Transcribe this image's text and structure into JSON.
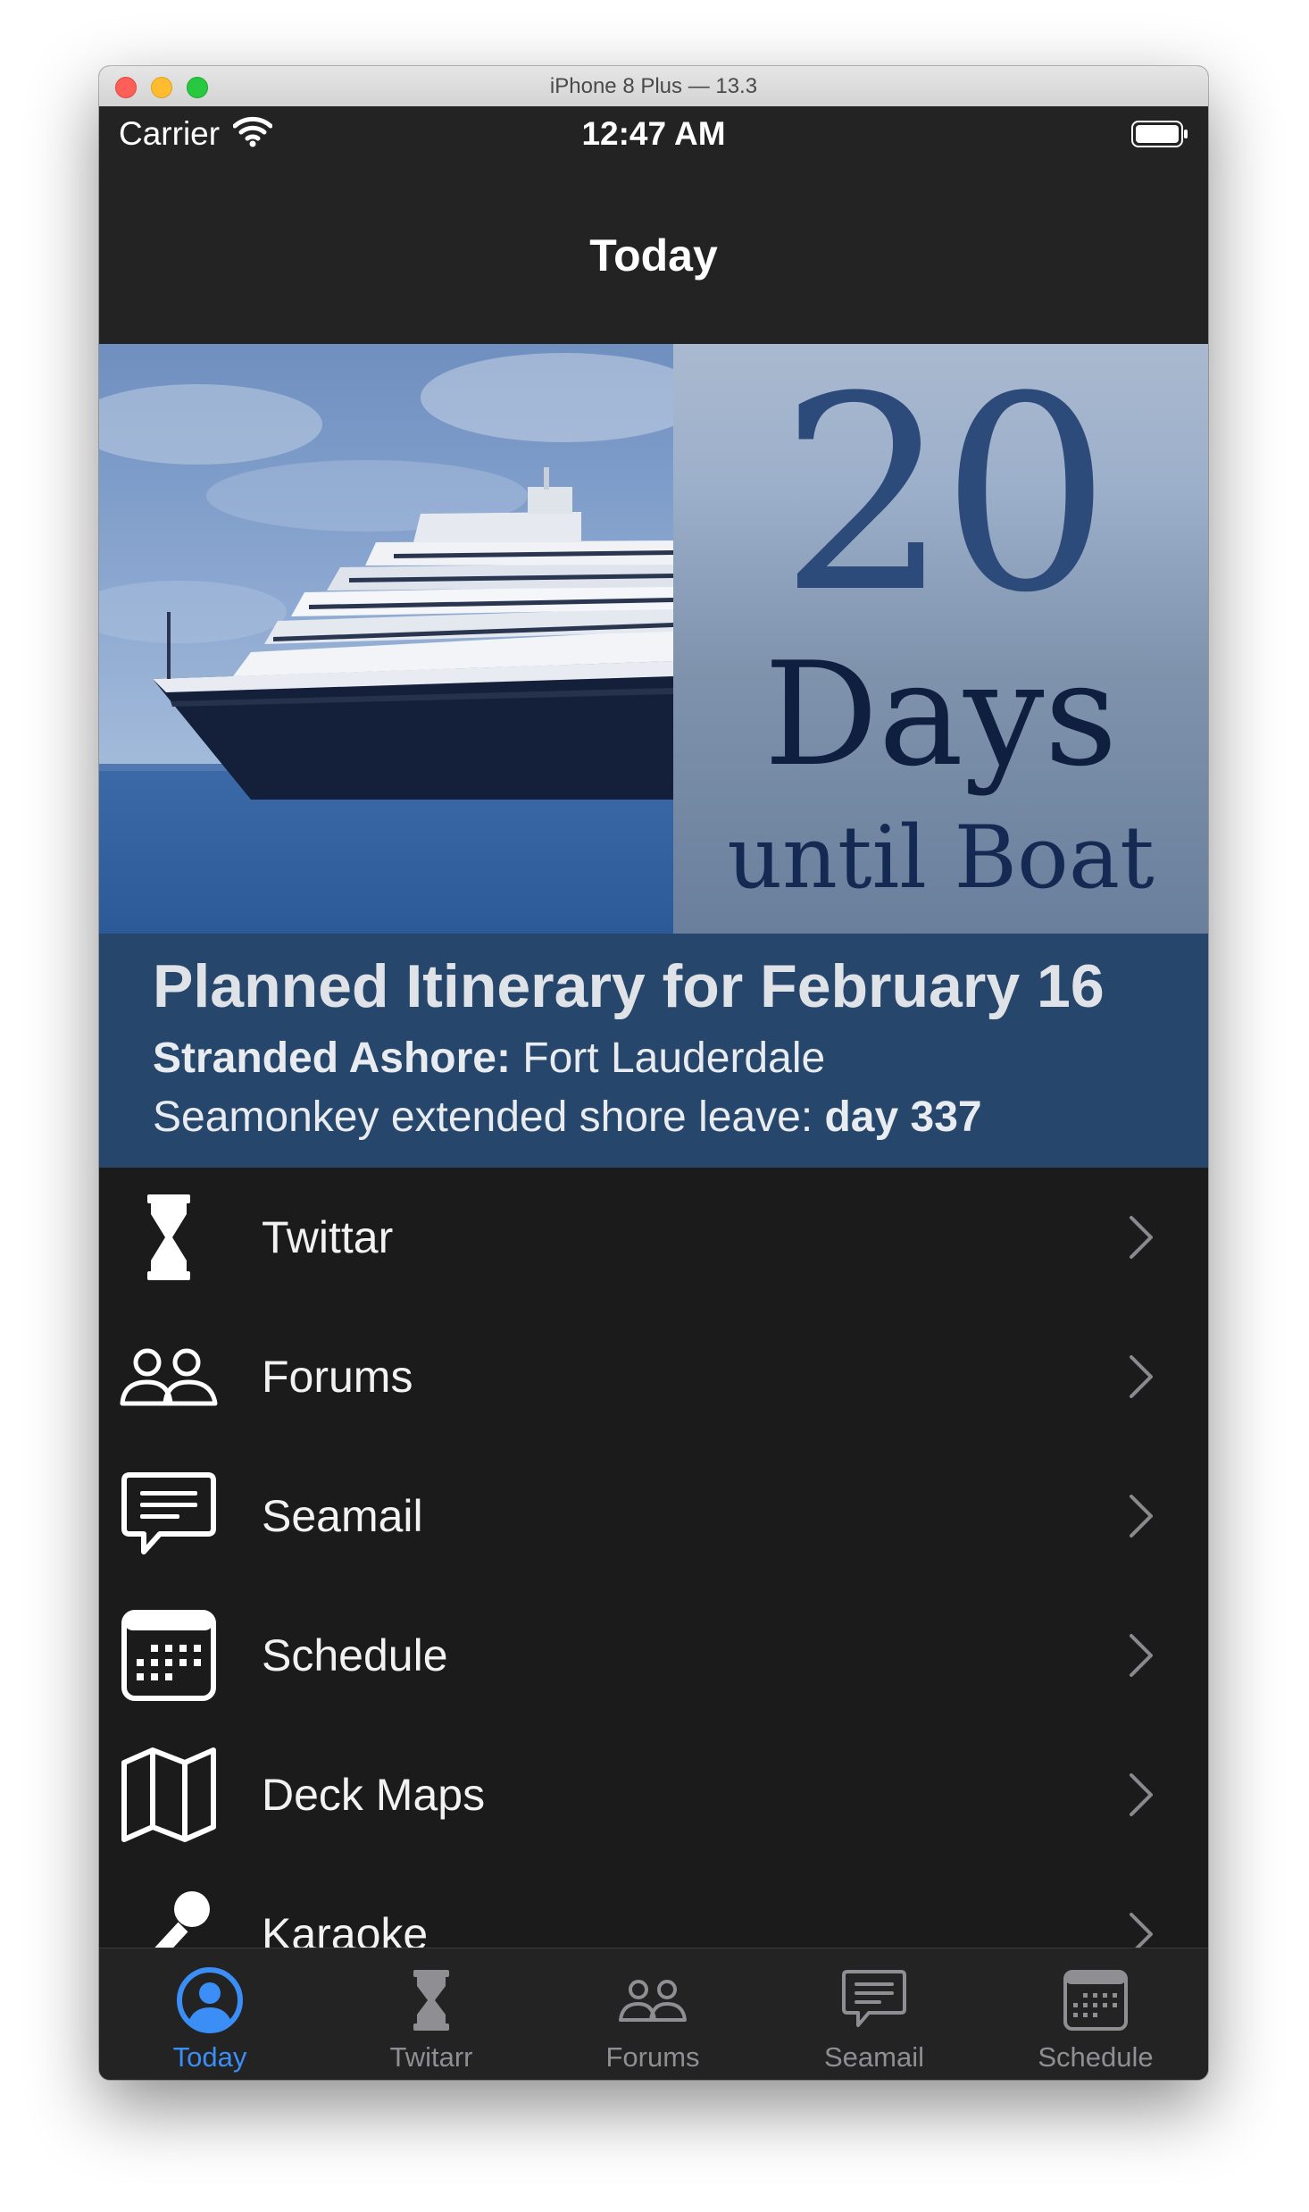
{
  "window": {
    "title": "iPhone 8 Plus — 13.3"
  },
  "status_bar": {
    "carrier": "Carrier",
    "time": "12:47 AM"
  },
  "nav": {
    "title": "Today"
  },
  "countdown": {
    "number": "20",
    "unit": "Days",
    "caption": "until Boat"
  },
  "itinerary": {
    "title": "Planned Itinerary for February 16",
    "line1_label": "Stranded Ashore:",
    "line1_value": " Fort Lauderdale",
    "line2_label": "Seamonkey extended shore leave: ",
    "line2_value": "day 337"
  },
  "menu": [
    {
      "label": "Twittar",
      "icon": "hourglass-icon"
    },
    {
      "label": "Forums",
      "icon": "people-icon"
    },
    {
      "label": "Seamail",
      "icon": "chat-bubble-icon"
    },
    {
      "label": "Schedule",
      "icon": "calendar-icon"
    },
    {
      "label": "Deck Maps",
      "icon": "map-icon"
    },
    {
      "label": "Karaoke",
      "icon": "microphone-icon"
    }
  ],
  "tabs": [
    {
      "label": "Today",
      "icon": "person-circle-icon",
      "active": true
    },
    {
      "label": "Twitarr",
      "icon": "hourglass-icon",
      "active": false
    },
    {
      "label": "Forums",
      "icon": "people-icon",
      "active": false
    },
    {
      "label": "Seamail",
      "icon": "chat-bubble-icon",
      "active": false
    },
    {
      "label": "Schedule",
      "icon": "calendar-icon",
      "active": false
    }
  ],
  "colors": {
    "accent": "#3a8ef6",
    "itinerary_bg": "#26476b",
    "list_bg": "#1b1b1b",
    "bar_bg": "#232323"
  }
}
